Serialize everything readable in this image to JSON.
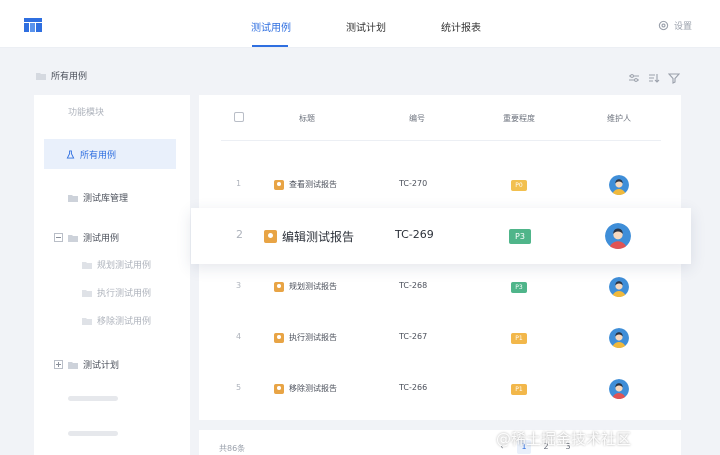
{
  "nav": {
    "tabs": [
      {
        "label": "测试用例",
        "active": true
      },
      {
        "label": "测试计划",
        "active": false
      },
      {
        "label": "统计报表",
        "active": false
      }
    ],
    "settings_label": "设置"
  },
  "breadcrumb": "所有用例",
  "sidebar": {
    "section_header": "功能模块",
    "all_cases": "所有用例",
    "repo_manage": "测试库管理",
    "test_cases": "测试用例",
    "sub_items": [
      "规划测试用例",
      "执行测试用例",
      "移除测试用例"
    ],
    "test_plan": "测试计划"
  },
  "table": {
    "headers": [
      "标题",
      "编号",
      "重要程度",
      "维护人"
    ],
    "rows": [
      {
        "num": "1",
        "title": "查看测试报告",
        "code": "TC-270",
        "priority": "P0",
        "color": "#f2c04f"
      },
      {
        "num": "2",
        "title": "编辑测试报告",
        "code": "TC-269",
        "priority": "P3",
        "color": "#4fb58a"
      },
      {
        "num": "3",
        "title": "规划测试报告",
        "code": "TC-268",
        "priority": "P3",
        "color": "#4fb58a"
      },
      {
        "num": "4",
        "title": "执行测试报告",
        "code": "TC-267",
        "priority": "P1",
        "color": "#f2b74a"
      },
      {
        "num": "5",
        "title": "移除测试报告",
        "code": "TC-266",
        "priority": "P1",
        "color": "#f2b74a"
      }
    ]
  },
  "footer": {
    "total": "共86条",
    "pages": [
      "1",
      "2",
      "3"
    ]
  },
  "watermark": "@稀土掘金技术社区",
  "colors": {
    "accent": "#2f6fe0",
    "icon_orange": "#e8a445"
  }
}
